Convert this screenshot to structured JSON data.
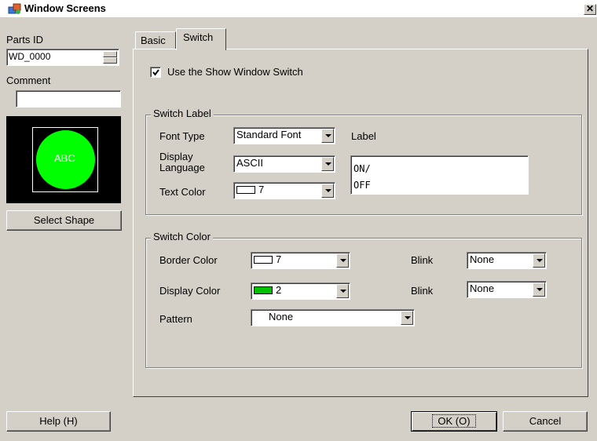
{
  "window": {
    "title": "Window Screens",
    "close_glyph": "✕"
  },
  "left": {
    "parts_id_label": "Parts ID",
    "parts_id_value": "WD_0000",
    "comment_label": "Comment",
    "comment_value": "",
    "preview_text": "ABC",
    "select_shape_label": "Select Shape"
  },
  "tabs": [
    {
      "label": "Basic"
    },
    {
      "label": "Switch"
    }
  ],
  "switch_tab": {
    "use_switch_label": "Use the Show Window Switch",
    "use_switch_checked": true,
    "label_group": {
      "title": "Switch Label",
      "font_type_label": "Font Type",
      "font_type_value": "Standard Font",
      "display_language_label_1": "Display",
      "display_language_label_2": "Language",
      "display_language_value": "ASCII",
      "text_color_label": "Text Color",
      "text_color_value": "7",
      "label_label": "Label",
      "label_line_1": "ON/",
      "label_line_2": "OFF"
    },
    "color_group": {
      "title": "Switch Color",
      "border_color_label": "Border Color",
      "border_color_value": "7",
      "blink_label_1": "Blink",
      "blink_value_1": "None",
      "display_color_label": "Display Color",
      "display_color_value": "2",
      "blink_label_2": "Blink",
      "blink_value_2": "None",
      "pattern_label": "Pattern",
      "pattern_value": "None"
    }
  },
  "footer": {
    "help_label": "Help (H)",
    "ok_label": "OK (O)",
    "cancel_label": "Cancel"
  },
  "colors": {
    "dialog_bg": "#d4d0c8",
    "preview_bg": "#000000",
    "preview_circle": "#00ff00",
    "color_7": "#ffffff",
    "color_2": "#00c000"
  }
}
